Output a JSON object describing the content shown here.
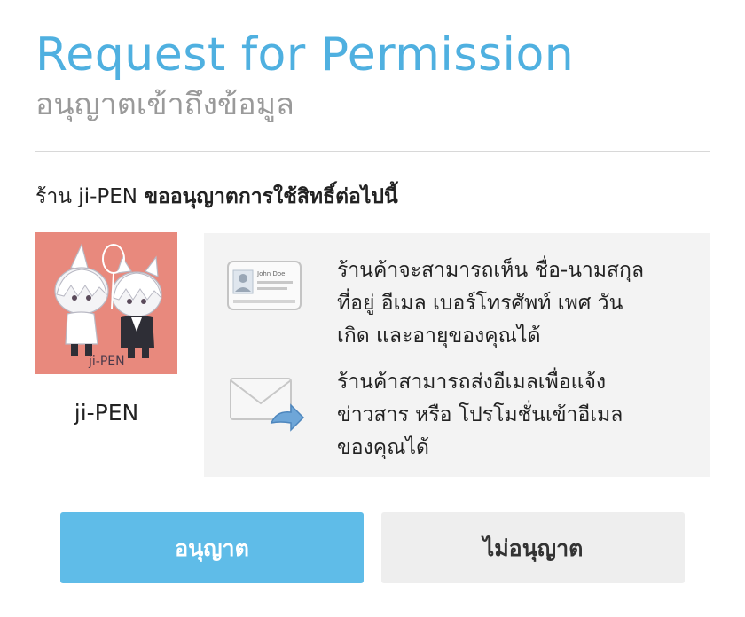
{
  "dialog": {
    "title": "Request for Permission",
    "subtitle": "อนุญาตเข้าถึงข้อมูล"
  },
  "request": {
    "shop_prefix": "ร้าน ji-PEN",
    "ask_text": "ขออนุญาตการใช้สิทธิ์ต่อไปนี้"
  },
  "shop": {
    "name": "ji-PEN",
    "avatar_caption": "ji-PEN",
    "avatar_bg": "#e8897d"
  },
  "permissions": [
    {
      "icon": "contact-card-icon",
      "card_name": "John Doe",
      "line1": "ร้านค้าจะสามารถเห็น ชื่อ-นามสกุล",
      "line2": "ที่อยู่ อีเมล เบอร์โทรศัพท์ เพศ วัน",
      "line3": "เกิด และอายุของคุณได้"
    },
    {
      "icon": "email-envelope-icon",
      "line1": "ร้านค้าสามารถส่งอีเมลเพื่อแจ้ง",
      "line2": "ข่าวสาร หรือ โปรโมชั่นเข้าอีเมล",
      "line3": "ของคุณได้"
    }
  ],
  "buttons": {
    "allow_label": "อนุญาต",
    "deny_label": "ไม่อนุญาต"
  },
  "colors": {
    "accent": "#4fb0e0",
    "allow_button": "#5fbce8",
    "deny_button": "#eeeeee",
    "panel": "#f3f3f3"
  }
}
